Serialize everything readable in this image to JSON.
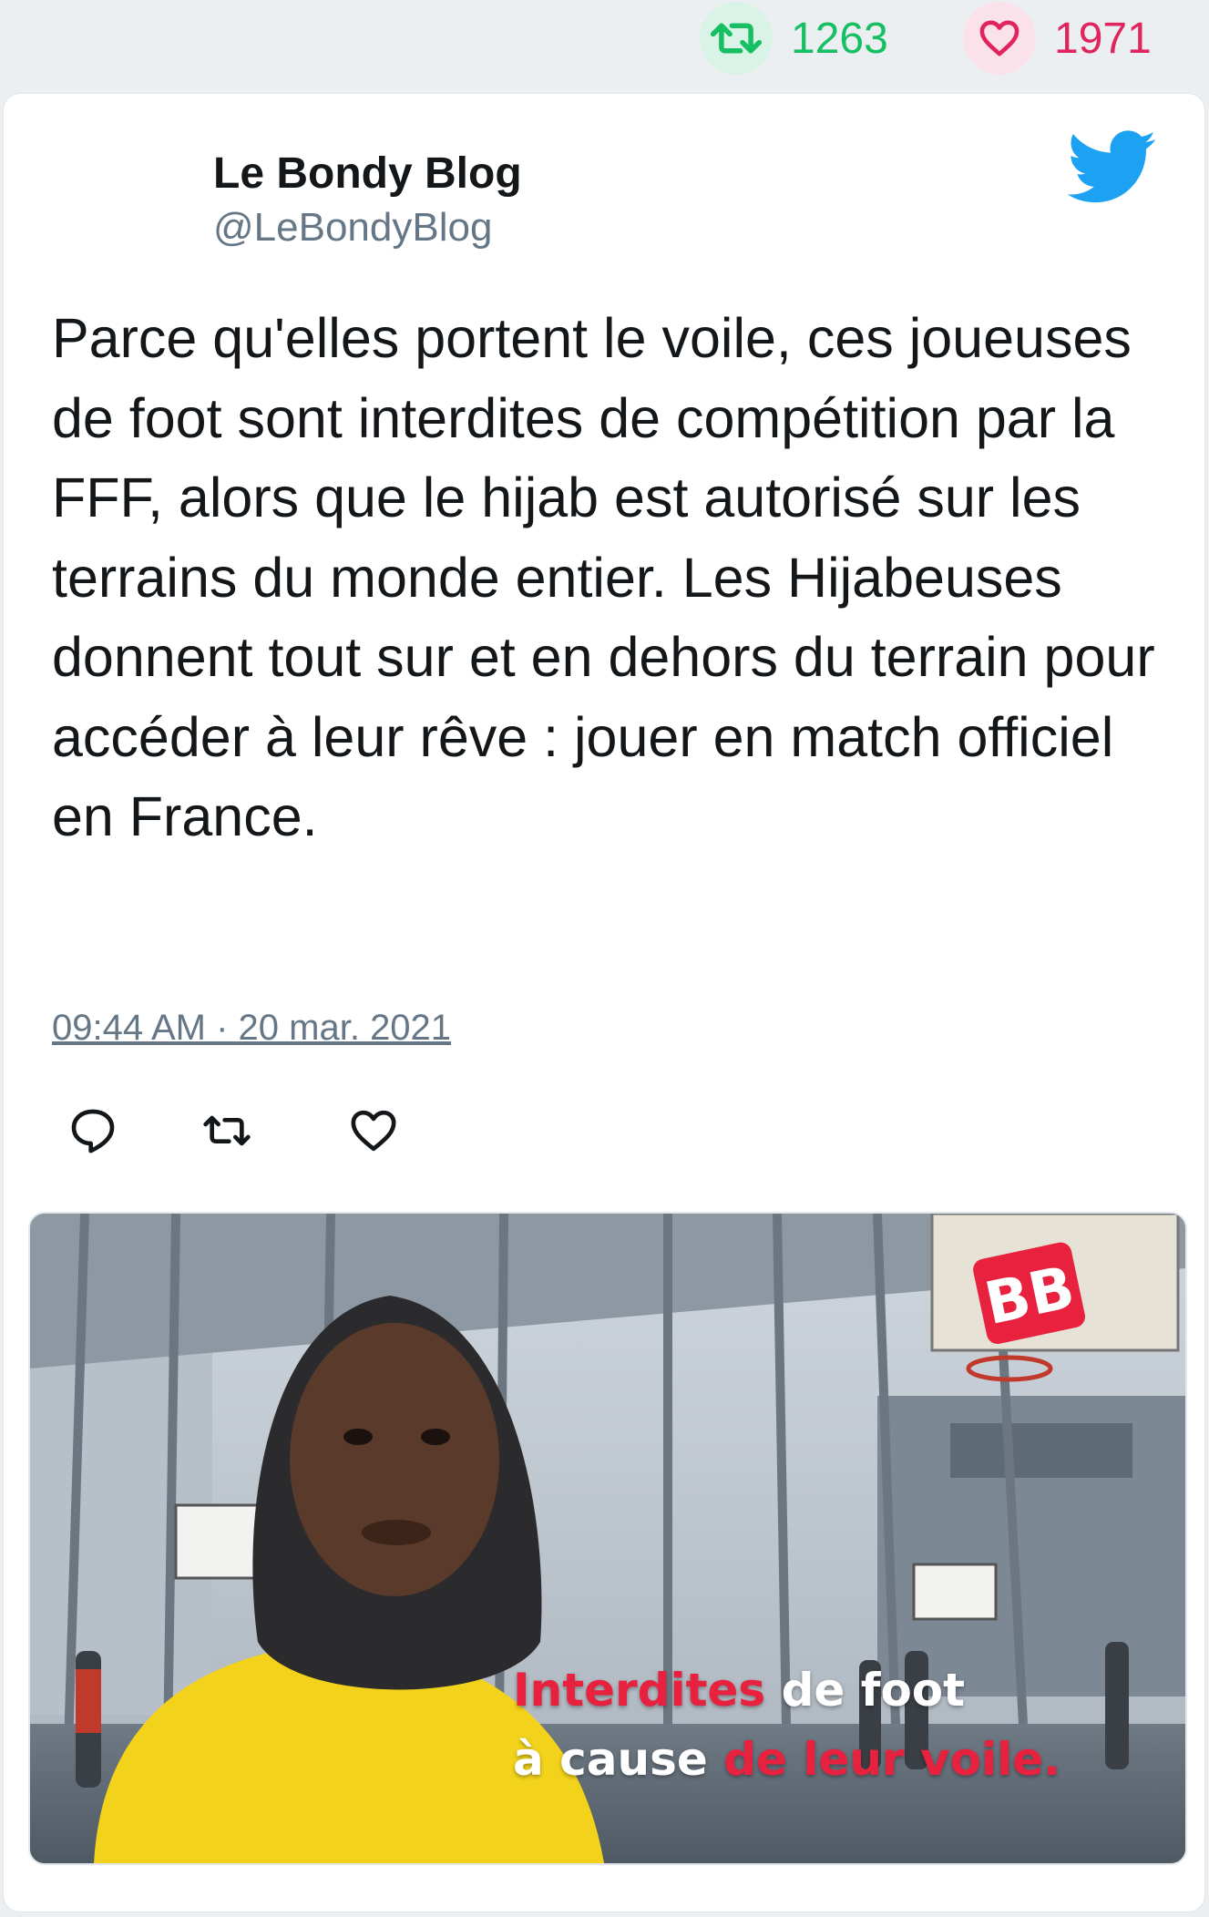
{
  "stats": {
    "retweets": "1263",
    "likes": "1971",
    "retweet_color": "#17bf63",
    "like_color": "#e0245e"
  },
  "author": {
    "name": "Le Bondy Blog",
    "handle": "@LeBondyBlog"
  },
  "brand_icon": "twitter-bird-icon",
  "tweet": {
    "text": "Parce qu'elles portent le voile, ces joueuses de foot sont interdites de compétition par la FFF, alors que le hijab est autorisé sur les terrains du monde entier. Les Hijabeuses donnent tout sur et en dehors du terrain pour accéder à leur rêve : jouer en match officiel en France.",
    "timestamp": "09:44 AM · 20 mar. 2021"
  },
  "actions": [
    "reply-icon",
    "retweet-icon",
    "like-icon"
  ],
  "media": {
    "logo_text": "BB",
    "caption_line1": {
      "red": "Interdites",
      "white": " de foot"
    },
    "caption_line2": {
      "white": "à cause ",
      "red": "de leur voile."
    }
  }
}
